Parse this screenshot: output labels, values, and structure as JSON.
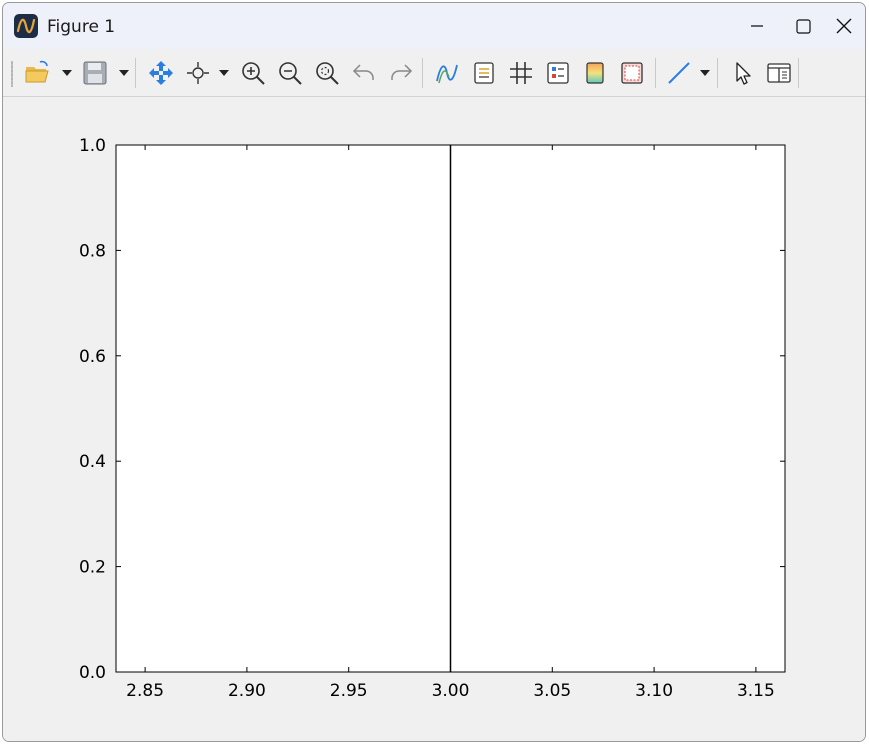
{
  "window": {
    "title": "Figure 1",
    "controls": [
      "minimize",
      "maximize",
      "close"
    ]
  },
  "toolbar": {
    "items": [
      {
        "name": "open-folder-icon",
        "dropdown": true
      },
      {
        "name": "save-icon",
        "dropdown": true
      },
      {
        "name": "pan-icon",
        "dropdown": false
      },
      {
        "name": "data-cursor-icon",
        "dropdown": true
      },
      {
        "name": "zoom-in-icon",
        "dropdown": false
      },
      {
        "name": "zoom-out-icon",
        "dropdown": false
      },
      {
        "name": "zoom-reset-icon",
        "dropdown": false
      },
      {
        "name": "undo-icon",
        "dropdown": false
      },
      {
        "name": "redo-icon",
        "dropdown": false
      },
      {
        "name": "curve-style-icon",
        "dropdown": false
      },
      {
        "name": "legend-icon",
        "dropdown": false
      },
      {
        "name": "grid-icon",
        "dropdown": false
      },
      {
        "name": "properties-icon",
        "dropdown": false
      },
      {
        "name": "colormap-icon",
        "dropdown": false
      },
      {
        "name": "frame-icon",
        "dropdown": false
      },
      {
        "name": "line-tool-icon",
        "dropdown": true
      },
      {
        "name": "select-pointer-icon",
        "dropdown": false
      },
      {
        "name": "panel-toggle-icon",
        "dropdown": false
      }
    ]
  },
  "chart_data": {
    "type": "line",
    "title": "",
    "xlabel": "",
    "ylabel": "",
    "xlim": [
      2.8357,
      3.1643
    ],
    "ylim": [
      0.0,
      1.0
    ],
    "xticks": [
      "2.85",
      "2.90",
      "2.95",
      "3.00",
      "3.05",
      "3.10",
      "3.15"
    ],
    "xtick_values": [
      2.85,
      2.9,
      2.95,
      3.0,
      3.05,
      3.1,
      3.15
    ],
    "yticks": [
      "0.0",
      "0.2",
      "0.4",
      "0.6",
      "0.8",
      "1.0"
    ],
    "ytick_values": [
      0.0,
      0.2,
      0.4,
      0.6,
      0.8,
      1.0
    ],
    "grid": false,
    "series": [
      {
        "x": [
          3.0,
          3.0
        ],
        "y": [
          0.0,
          1.0
        ],
        "color": "#000000"
      }
    ]
  }
}
